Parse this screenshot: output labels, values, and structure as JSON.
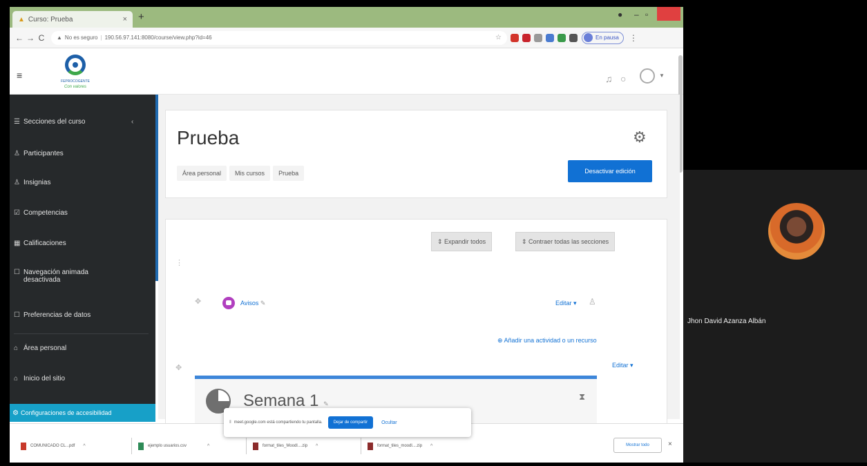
{
  "browser": {
    "tab_title": "Curso: Prueba",
    "new_tab": "+",
    "url_security": "No es seguro",
    "url": "190.56.97.141:8080/course/view.php?id=46",
    "profile_label": "En pausa"
  },
  "header": {
    "logo_text_1": "FEPROCOGENTE",
    "logo_text_2": "Con valores"
  },
  "drawer": {
    "items": [
      {
        "icon": "☰",
        "label": "Secciones del curso"
      },
      {
        "icon": "♙",
        "label": "Participantes"
      },
      {
        "icon": "♙",
        "label": "Insignias"
      },
      {
        "icon": "☑",
        "label": "Competencias"
      },
      {
        "icon": "▦",
        "label": "Calificaciones"
      },
      {
        "icon": "☐",
        "label": "Navegación animada",
        "label2": "desactivada"
      },
      {
        "icon": "☐",
        "label": "Preferencias de datos"
      },
      {
        "icon": "⌂",
        "label": "Área personal"
      },
      {
        "icon": "⌂",
        "label": "Inicio del sitio"
      }
    ],
    "accessibility": "Configuraciones de accesibilidad"
  },
  "page": {
    "title": "Prueba",
    "breadcrumb": [
      "Área personal",
      "Mis cursos",
      "Prueba"
    ],
    "edit_button": "Desactivar edición"
  },
  "course": {
    "expand_all": "Expandir todos",
    "collapse_all": "Contraer todas las secciones",
    "activity_name": "Avisos",
    "edit_label": "Editar",
    "add_activity": "Añadir una actividad o un recurso",
    "week_title": "Semana 1"
  },
  "share": {
    "message": "meet.google.com está compartiendo tu pantalla.",
    "stop_button": "Dejar de compartir",
    "hide_button": "Ocultar"
  },
  "downloads": {
    "items": [
      {
        "name": "COMUNICADO CL...pdf",
        "color": "#c8392b"
      },
      {
        "name": "ejemplo usuarios.csv",
        "color": "#2e8b57"
      },
      {
        "name": "format_tiles_Moodl....zip",
        "color": "#8b2b2b"
      },
      {
        "name": "format_tiles_moodl....zip",
        "color": "#8b2b2b"
      }
    ],
    "show_all": "Mostrar todo"
  },
  "participant": {
    "name": "Jhon David Azanza Albán"
  },
  "colors": {
    "moodle_blue": "#1171d4",
    "drawer_bg": "#26292b",
    "accessibility_bg": "#17a0c8",
    "tabbar_bg": "#9cba7f"
  }
}
